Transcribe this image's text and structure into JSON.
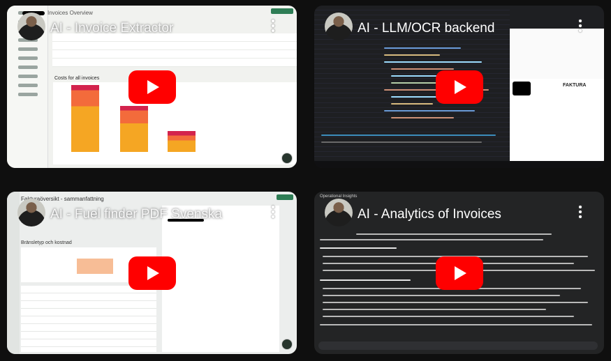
{
  "videos": [
    {
      "title": "AI - Invoice Extractor",
      "app_heading": "Invoices Overview",
      "section": "Costs for all invoices"
    },
    {
      "title": "AI - LLM/OCR backend",
      "invoice_doc_title": "FAKTURA"
    },
    {
      "title": "AI - Fuel finder PDF Svenska",
      "app_heading": "Fakturaöversikt - sammanfattning",
      "section": "Bränsletyp och kostnad"
    },
    {
      "title": "AI - Analytics of Invoices",
      "app_heading": "Operational Insights"
    }
  ],
  "colors": {
    "play_button": "#ff0000",
    "bar_top": "#d3234d",
    "bar_mid": "#f36b3b",
    "bar_base": "#f5a623"
  }
}
